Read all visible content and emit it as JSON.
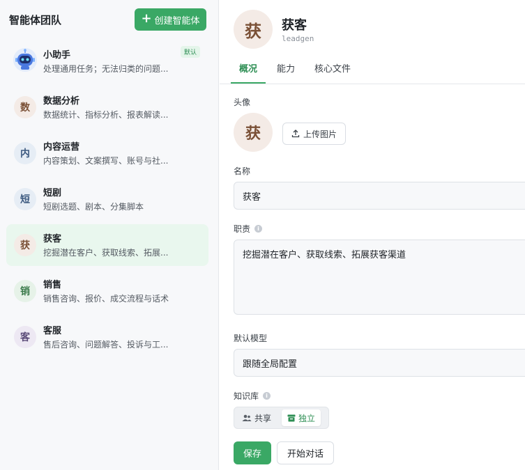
{
  "sidebar": {
    "title": "智能体团队",
    "create_label": "创建智能体",
    "agents": [
      {
        "name": "小助手",
        "desc": "处理通用任务；无法归类的问题...",
        "badge": "默认",
        "avatar": "robot",
        "avatar_bg": "#e8eef9"
      },
      {
        "name": "数据分析",
        "desc": "数据统计、指标分析、报表解读...",
        "avatar": "数",
        "avatar_bg": "#f4ebe6",
        "avatar_color": "#7a5036"
      },
      {
        "name": "内容运营",
        "desc": "内容策划、文案撰写、账号与社...",
        "avatar": "内",
        "avatar_bg": "#e6edf5",
        "avatar_color": "#3d5a80"
      },
      {
        "name": "短剧",
        "desc": "短剧选题、剧本、分集脚本",
        "avatar": "短",
        "avatar_bg": "#e6edf5",
        "avatar_color": "#3d5a80"
      },
      {
        "name": "获客",
        "desc": "挖掘潜在客户、获取线索、拓展...",
        "avatar": "获",
        "avatar_bg": "#f4ebe6",
        "avatar_color": "#7a5036",
        "active": true
      },
      {
        "name": "销售",
        "desc": "销售咨询、报价、成交流程与话术",
        "avatar": "销",
        "avatar_bg": "#e6f2e8",
        "avatar_color": "#3a7a4a"
      },
      {
        "name": "客服",
        "desc": "售后咨询、问题解答、投诉与工...",
        "avatar": "客",
        "avatar_bg": "#ede8f3",
        "avatar_color": "#5a4a78"
      }
    ]
  },
  "header": {
    "avatar": "获",
    "name": "获客",
    "id": "leadgen"
  },
  "tabs": [
    "概况",
    "能力",
    "核心文件"
  ],
  "form": {
    "avatar_label": "头像",
    "avatar_char": "获",
    "upload_label": "上传图片",
    "name_label": "名称",
    "name_value": "获客",
    "role_label": "职责",
    "role_value": "挖掘潜在客户、获取线索、拓展获客渠道",
    "model_label": "默认模型",
    "model_value": "跟随全局配置",
    "kb_label": "知识库",
    "kb_shared": "共享",
    "kb_independent": "独立",
    "save_label": "保存",
    "chat_label": "开始对话"
  },
  "colors": {
    "accent": "#3aa865",
    "accent_text": "#2f8f55",
    "active_bg": "#e9f7ee"
  }
}
